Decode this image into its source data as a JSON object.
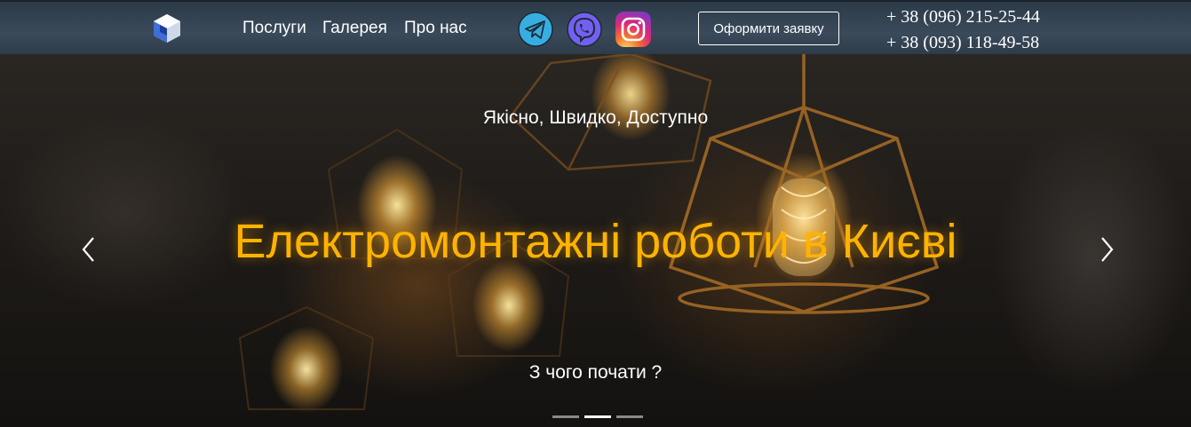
{
  "nav": {
    "links": [
      "Послуги",
      "Галерея",
      "Про нас"
    ],
    "social": [
      "telegram-icon",
      "viber-icon",
      "instagram-icon"
    ],
    "order_button": "Оформити заявку",
    "phones": [
      "+ 38 (096) 215-25-44",
      "+ 38 (093) 118-49-58"
    ]
  },
  "hero": {
    "tagline": "Якісно, Швидко, Доступно",
    "headline": "Електромонтажні роботи в Києві",
    "cta": "З чого почати ?",
    "slides_count": 3,
    "active_slide": 2
  },
  "colors": {
    "navbar": "#34424f",
    "headline": "#ffb300",
    "telegram": "#37aee2",
    "viber": "#7360f2"
  }
}
